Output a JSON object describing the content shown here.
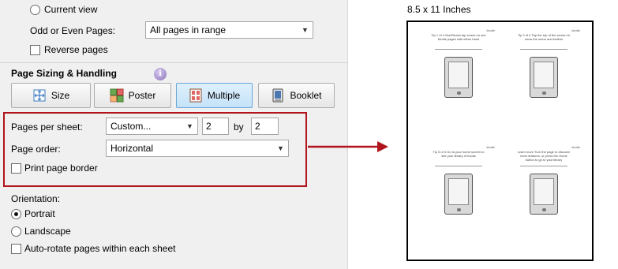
{
  "range": {
    "current_view_label": "Current view",
    "odd_even_label": "Odd or Even Pages:",
    "odd_even_value": "All pages in range",
    "reverse_pages_label": "Reverse pages"
  },
  "sizing": {
    "title": "Page Sizing & Handling",
    "info_icon_glyph": "i",
    "tabs": [
      {
        "label": "Size",
        "icon": "resize-icon",
        "active": false
      },
      {
        "label": "Poster",
        "icon": "poster-icon",
        "active": false
      },
      {
        "label": "Multiple",
        "icon": "multiple-pages-icon",
        "active": true
      },
      {
        "label": "Booklet",
        "icon": "booklet-icon",
        "active": false
      }
    ]
  },
  "multiple": {
    "pages_per_sheet_label": "Pages per sheet:",
    "pages_per_sheet_value": "Custom...",
    "columns_value": "2",
    "by_label": "by",
    "rows_value": "2",
    "page_order_label": "Page order:",
    "page_order_value": "Horizontal",
    "print_border_label": "Print page border"
  },
  "orientation": {
    "title": "Orientation:",
    "portrait_label": "Portrait",
    "landscape_label": "Landscape",
    "auto_rotate_label": "Auto-rotate pages within each sheet",
    "selected": "Portrait"
  },
  "preview": {
    "paper_size": "8.5 x 11 Inches",
    "thumbnails": [
      {
        "caption": "Tip 1 of 4\nSee/Reach tap screen to see Kindle pages with either hand",
        "brand": "kindle"
      },
      {
        "caption": "Tip 2 of 4\nTap the top of the screen to show the menu and toolbar",
        "brand": "kindle"
      },
      {
        "caption": "Tip 3 of 4\nGo to your home screen to see your library of books",
        "brand": "kindle"
      },
      {
        "caption": "Learn more\nTurn the page to discover more features, or press the Home button to go to your library",
        "brand": "kindle"
      }
    ]
  },
  "colors": {
    "highlight_red": "#b0141c",
    "active_tab": "#c4e2f8",
    "panel_bg": "#f0f0f0"
  }
}
